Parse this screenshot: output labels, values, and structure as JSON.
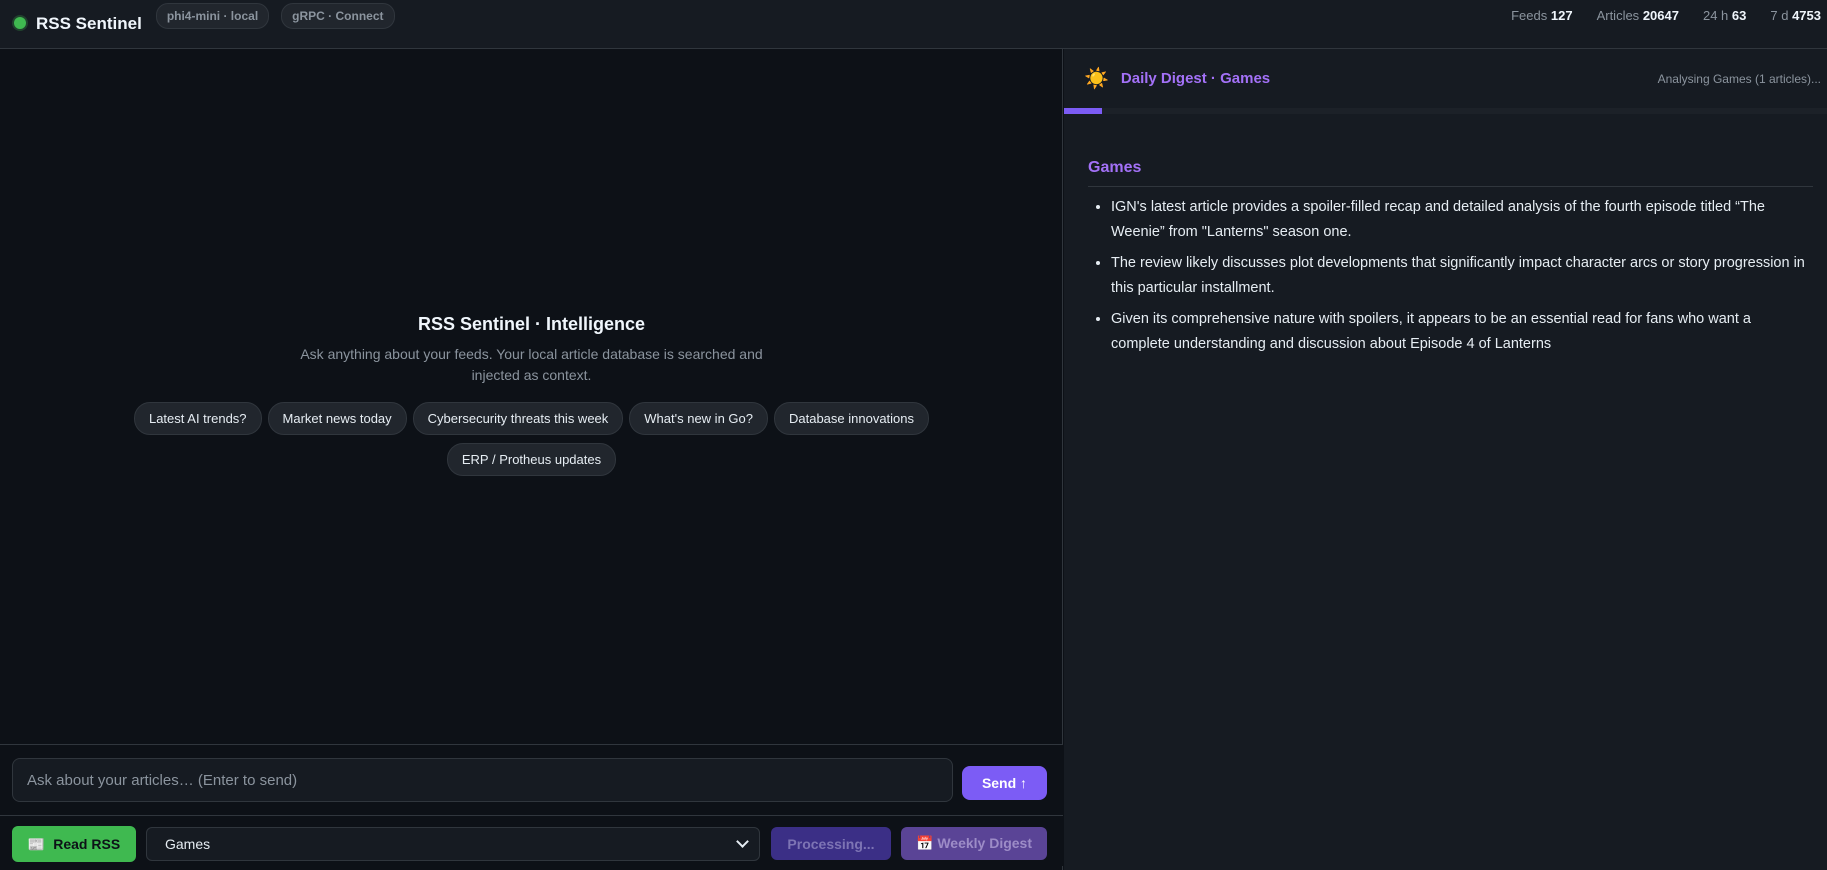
{
  "header": {
    "app_title": "RSS Sentinel",
    "model_pill": "phi4-mini · local",
    "transport_pill": "gRPC · Connect",
    "stats": [
      {
        "label": "Feeds",
        "value": "127"
      },
      {
        "label": "Articles",
        "value": "20647"
      },
      {
        "label": "24 h",
        "value": "63"
      },
      {
        "label": "7 d",
        "value": "4753"
      }
    ],
    "status_color": "#3fb950"
  },
  "chat": {
    "intro_title": "RSS Sentinel · Intelligence",
    "intro_desc": "Ask anything about your feeds. Your local article database is searched and injected as context.",
    "suggestions": [
      "Latest AI trends?",
      "Market news today",
      "Cybersecurity threats this week",
      "What's new in Go?",
      "Database innovations",
      "ERP / Protheus updates"
    ],
    "input_placeholder": "Ask about your articles… (Enter to send)",
    "send_label": "Send ↑"
  },
  "controls": {
    "read_rss_label": "Read RSS",
    "read_rss_icon": "newspaper-icon",
    "selected_feed": "Games",
    "processing_label": "Processing...",
    "weekly_digest_label": "📅 Weekly Digest"
  },
  "digest": {
    "icon": "sun-icon",
    "title": "Daily Digest · Games",
    "status": "Analysing Games (1 articles)...",
    "progress": 0.05,
    "accent_color": "#a371f7",
    "section_title": "Games",
    "bullets": [
      "IGN's latest article provides a spoiler-filled recap and detailed analysis of the fourth episode titled “The Weenie” from \"Lanterns\" season one.",
      "The review likely discusses plot developments that significantly impact character arcs or story progression in this particular installment.",
      "Given its comprehensive nature with spoilers, it appears to be an essential read for fans who want a complete understanding and discussion about Episode 4 of Lanterns"
    ]
  }
}
